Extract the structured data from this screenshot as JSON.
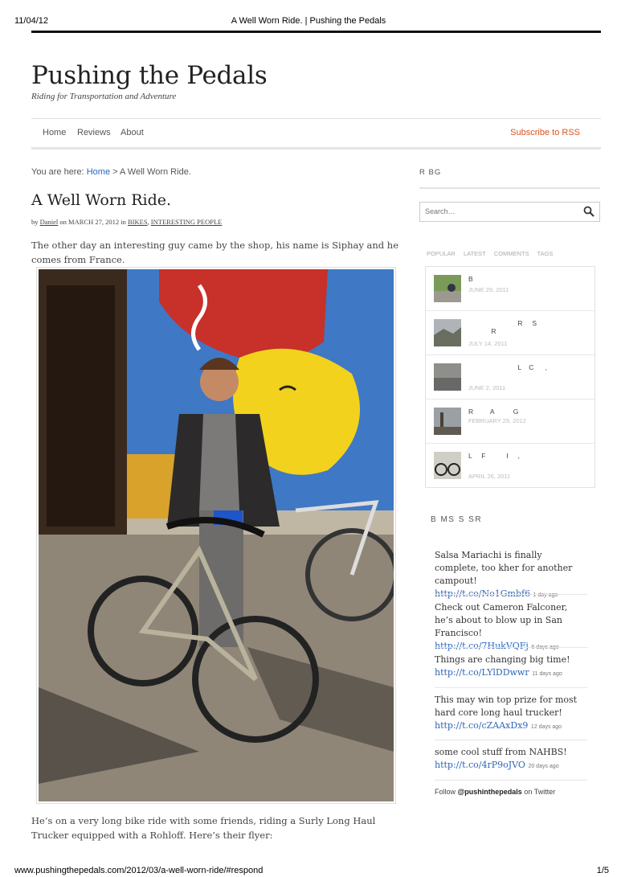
{
  "print_header": {
    "date": "11/04/12",
    "title": "A Well Worn Ride. | Pushing the Pedals"
  },
  "site": {
    "title": "Pushing the Pedals",
    "tagline": "Riding for Transportation and Adventure"
  },
  "nav": {
    "items": [
      "Home",
      "Reviews",
      "About"
    ],
    "rss": "Subscribe to RSS"
  },
  "breadcrumb": {
    "prefix": "You are here:",
    "home": "Home",
    "sep": ">",
    "current": "A Well Worn Ride."
  },
  "post": {
    "title": "A Well Worn Ride.",
    "by": "by",
    "author": "Daniel",
    "on": "on",
    "date": "MARCH 27, 2012",
    "in": "in",
    "cat1": "BIKES",
    "comma": ",",
    "cat2": "INTERESTING PEOPLE",
    "para1": "The other day an interesting guy came by the shop, his name is Siphay and he comes from France.",
    "para2": "He’s on a very long bike ride with some friends, riding a Surly Long Haul Trucker equipped with a Rohloff.  Here’s their flyer:"
  },
  "sidebar": {
    "heading1": "R    BG",
    "search_placeholder": "Search…",
    "tabs": [
      "POPULAR",
      "LATEST",
      "COMMENTS",
      "TAGS"
    ],
    "popular": [
      {
        "title": "B",
        "date": "JUNE 29, 2011"
      },
      {
        "title": "                          R     S\n            R",
        "date": "JULY 14, 2011"
      },
      {
        "title": "                          L    C      ,",
        "date": "JUNE 2, 2011"
      },
      {
        "title": "R         A          G",
        "date": "FEBRUARY 29, 2012"
      },
      {
        "title": "L     F           I     ,",
        "date": "APRIL 26, 2011"
      }
    ],
    "twitter_heading": "B MS S    SR",
    "tweets": [
      {
        "text": "Salsa Mariachi is finally complete, too kher for another campout!",
        "link": "http://t.co/No1Gmbf6",
        "ago": "1 day ago"
      },
      {
        "text": "Check out Cameron Falconer, he’s about to blow up in San Francisco!",
        "link": "http://t.co/7HukVQFj",
        "ago": "6 days ago"
      },
      {
        "text": "Things are changing big time!",
        "link": "http://t.co/LYlDDwwr",
        "ago": "11 days ago"
      },
      {
        "text": "This may win top prize for most hard core long haul trucker!",
        "link": "http://t.co/cZAAxDx9",
        "ago": "12 days ago"
      },
      {
        "text": "some cool stuff from NAHBS!",
        "link": "http://t.co/4rP9oJVO",
        "ago": "20 days ago"
      }
    ],
    "follow": {
      "prefix": "Follow",
      "handle": "@pushinthepedals",
      "suffix": "on Twitter"
    }
  },
  "print_footer": {
    "url": "www.pushingthepedals.com/2012/03/a-well-worn-ride/#respond",
    "page": "1/5"
  },
  "colors": {
    "accent_link": "#2a66b8",
    "rss": "#d9531e"
  }
}
